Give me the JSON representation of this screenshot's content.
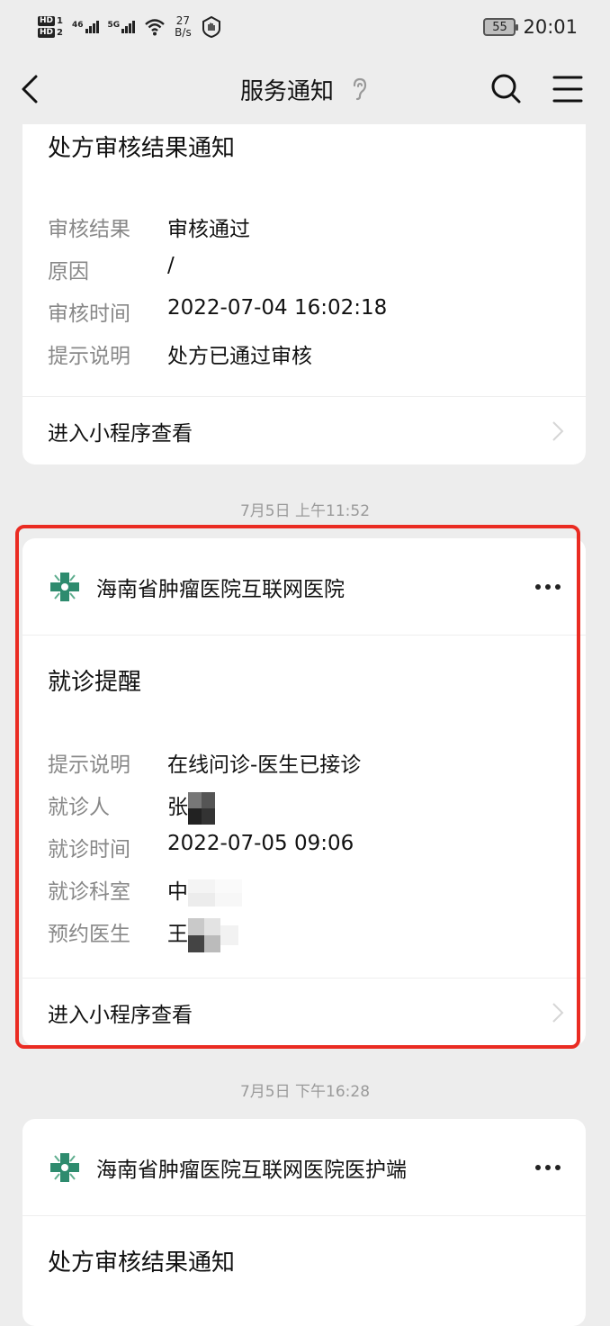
{
  "status_bar": {
    "net_gen_1": "46",
    "net_gen_2": "5G",
    "speed_value": "27",
    "speed_unit": "B/s",
    "battery": "55",
    "time": "20:01"
  },
  "nav": {
    "title": "服务通知"
  },
  "card1": {
    "title": "处方审核结果通知",
    "rows": [
      {
        "label": "审核结果",
        "value": "审核通过"
      },
      {
        "label": "原因",
        "value": "/"
      },
      {
        "label": "审核时间",
        "value": "2022-07-04 16:02:18"
      },
      {
        "label": "提示说明",
        "value": "处方已通过审核"
      }
    ],
    "footer": "进入小程序查看"
  },
  "timestamp1": "7月5日 上午11:52",
  "card2": {
    "account": "海南省肿瘤医院互联网医院",
    "title": "就诊提醒",
    "rows": [
      {
        "label": "提示说明",
        "value": "在线问诊-医生已接诊"
      },
      {
        "label": "就诊人",
        "value": "张"
      },
      {
        "label": "就诊时间",
        "value": "2022-07-05 09:06"
      },
      {
        "label": "就诊科室",
        "value": "中"
      },
      {
        "label": "预约医生",
        "value": "王"
      }
    ],
    "footer": "进入小程序查看"
  },
  "timestamp2": "7月5日 下午16:28",
  "card3": {
    "account": "海南省肿瘤医院互联网医院医护端",
    "title": "处方审核结果通知"
  },
  "colors": {
    "highlight": "#ea2b22",
    "background": "#ededed",
    "logo_green": "#2e8b6e"
  }
}
